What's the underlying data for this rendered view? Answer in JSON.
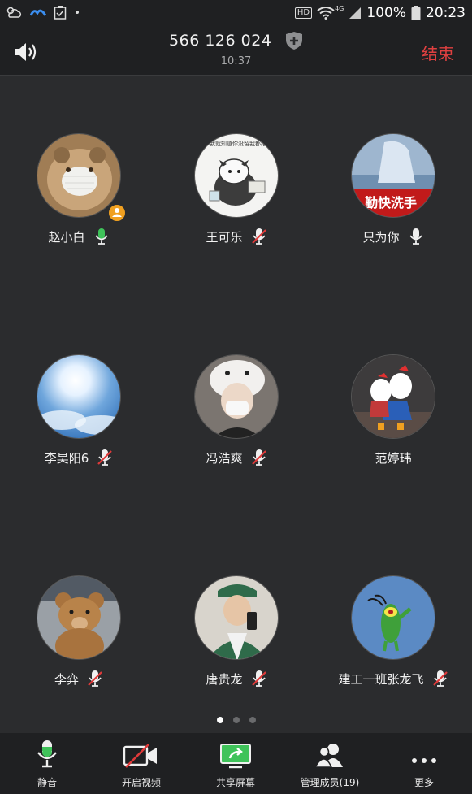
{
  "status_bar": {
    "hd": "HD",
    "network": "4G",
    "battery": "100%",
    "time": "20:23"
  },
  "meeting": {
    "id": "566 126 024",
    "elapsed": "10:37",
    "end_label": "结束"
  },
  "participants": [
    {
      "name": "赵小白",
      "mic": "on-green",
      "host": true
    },
    {
      "name": "王可乐",
      "mic": "muted"
    },
    {
      "name": "只为你",
      "mic": "on-white"
    },
    {
      "name": "李昊阳6",
      "mic": "muted"
    },
    {
      "name": "冯浩爽",
      "mic": "muted"
    },
    {
      "name": "范婷玮",
      "mic": "none"
    },
    {
      "name": "李弈",
      "mic": "muted"
    },
    {
      "name": "唐贵龙",
      "mic": "muted"
    },
    {
      "name": "建工一班张龙飞",
      "mic": "muted"
    }
  ],
  "avatar_texts": {
    "p2": "我就知道你没留我都给我什么",
    "p3": "勤快洗手"
  },
  "pagination": {
    "pages": 3,
    "current": 1
  },
  "toolbar": {
    "mute": "静音",
    "video": "开启视频",
    "share": "共享屏幕",
    "members": "管理成员(19)",
    "more": "更多"
  },
  "colors": {
    "accent_green": "#3fc35a",
    "end_red": "#e04040",
    "muted_red": "#e03a3a"
  }
}
